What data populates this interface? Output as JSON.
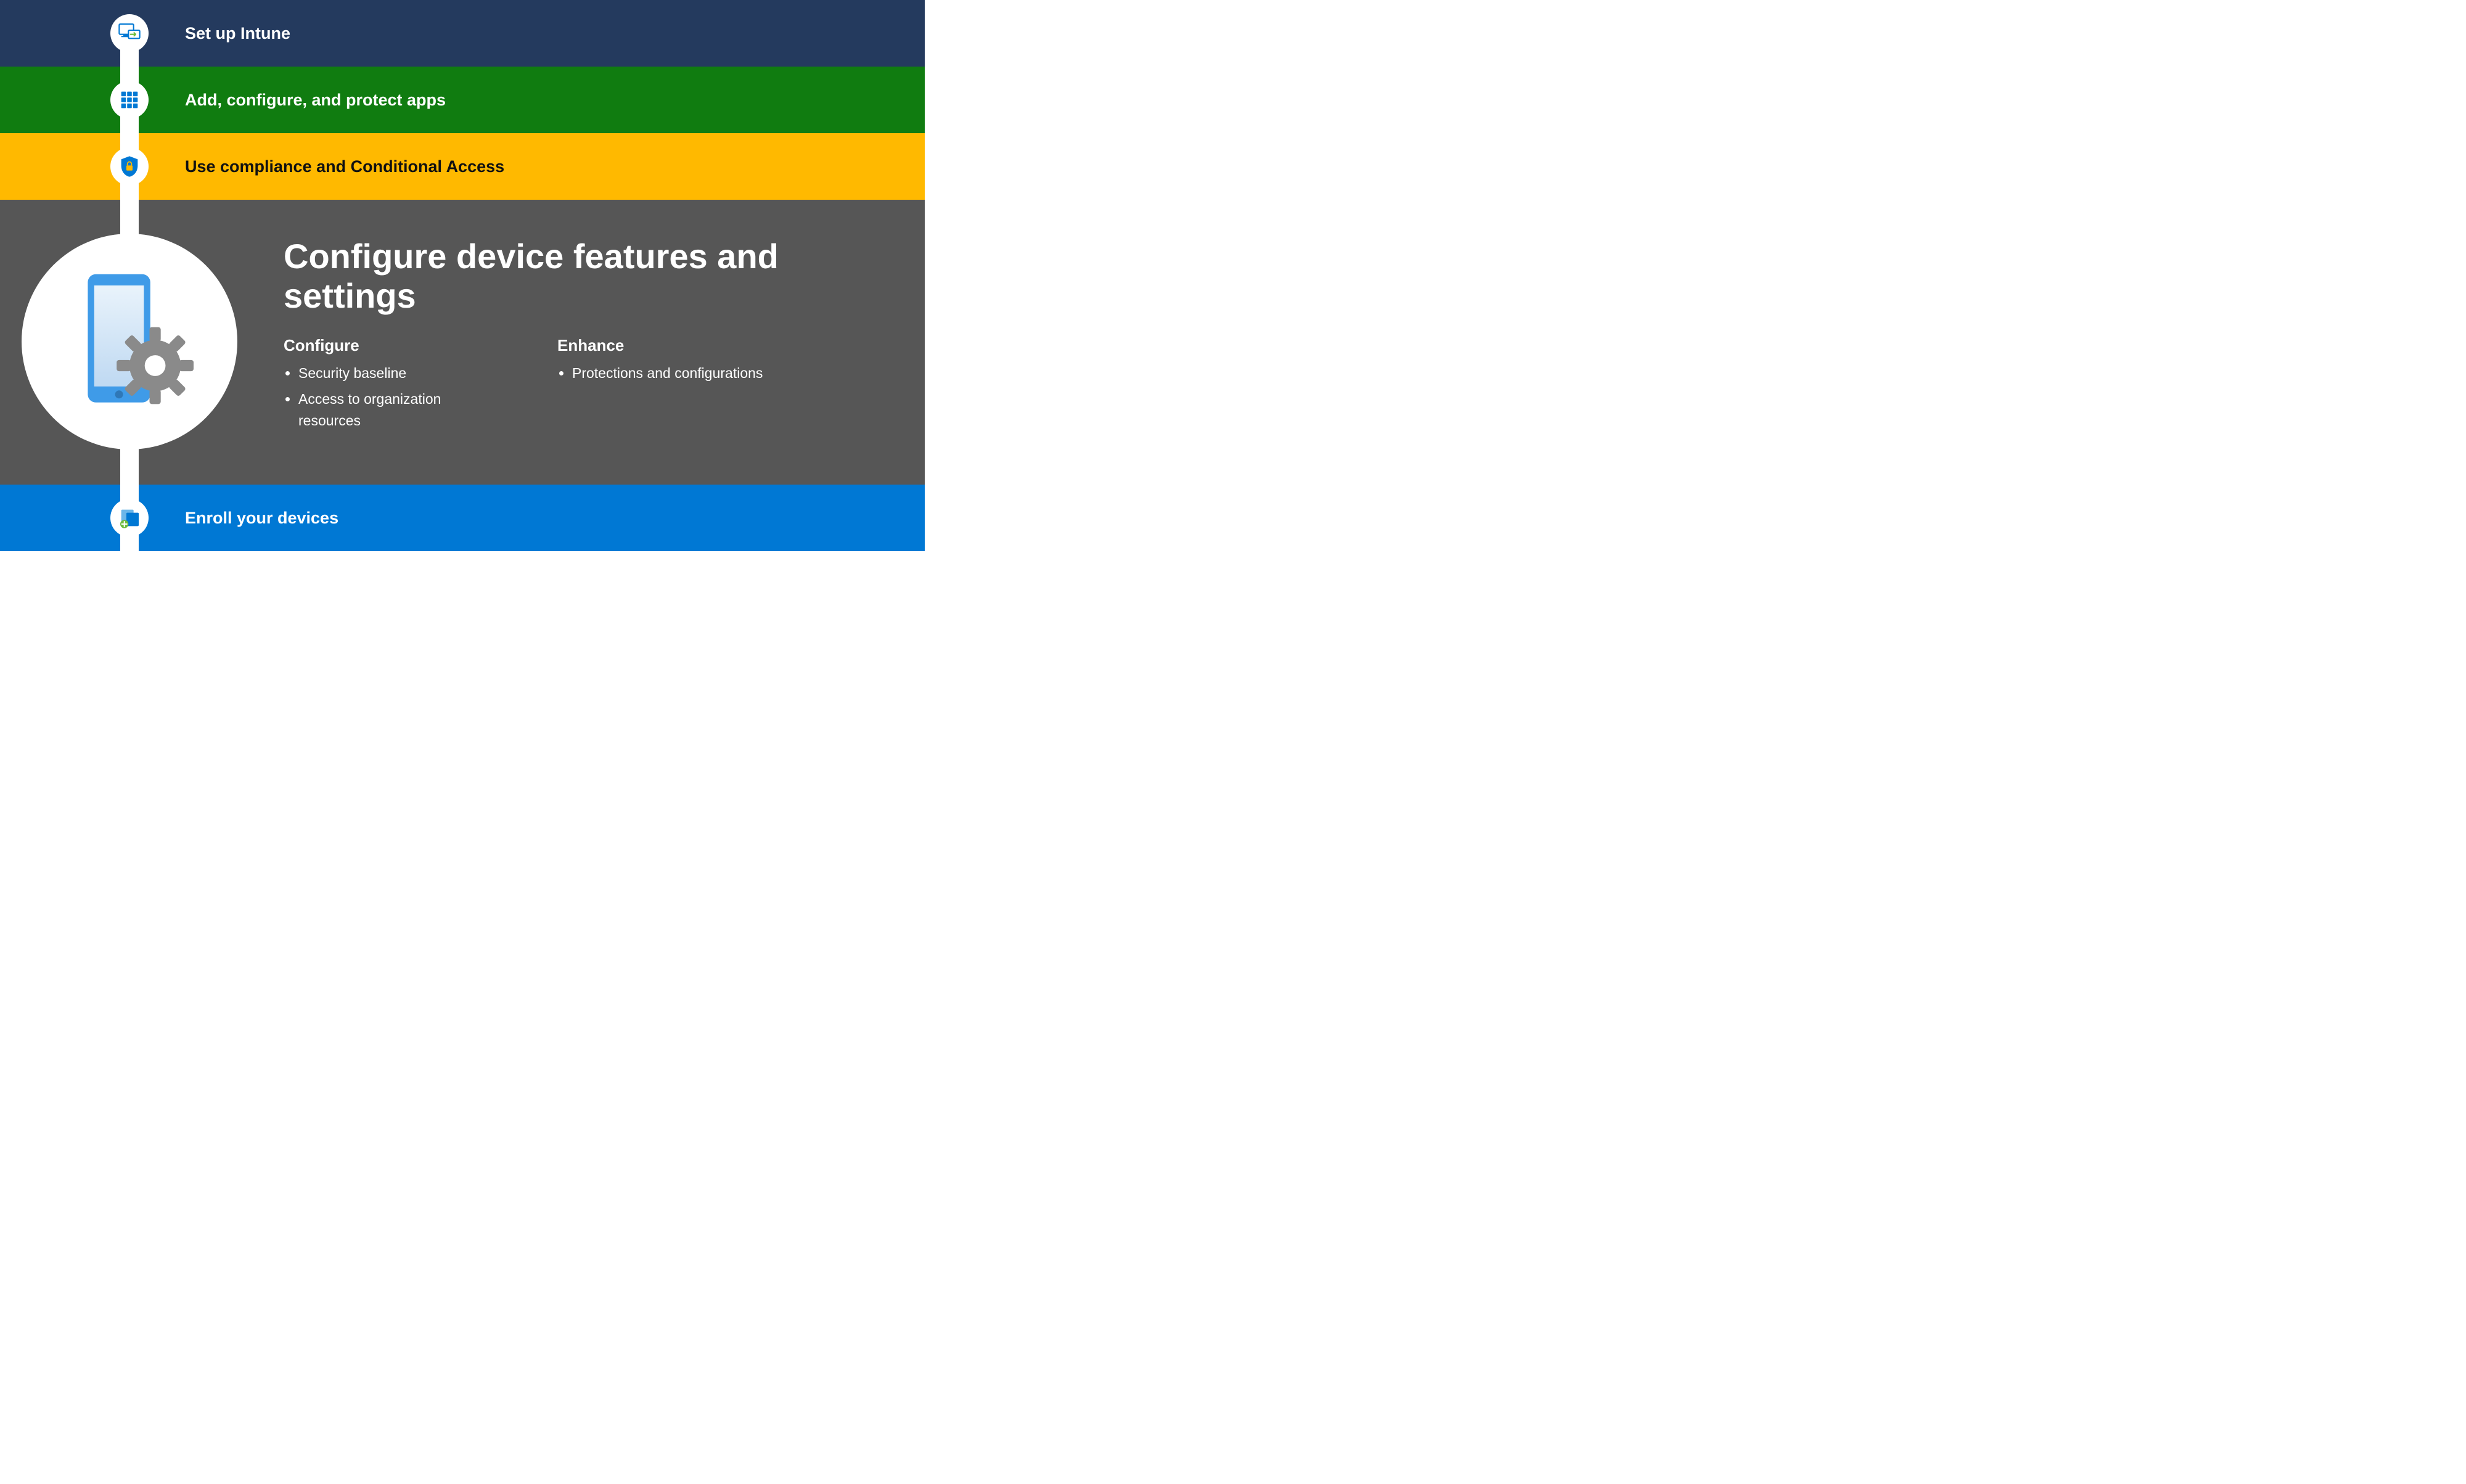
{
  "steps": {
    "s1": {
      "label": "Set up Intune",
      "icon": "monitor-arrow-icon"
    },
    "s2": {
      "label": "Add, configure, and protect apps",
      "icon": "apps-grid-icon"
    },
    "s3": {
      "label": "Use compliance and Conditional Access",
      "icon": "shield-lock-icon"
    },
    "s4": {
      "title": "Configure device features and settings",
      "icon": "device-gear-icon",
      "configure": {
        "heading": "Configure",
        "items": [
          "Security baseline",
          "Access to organization resources"
        ]
      },
      "enhance": {
        "heading": "Enhance",
        "items": [
          "Protections and configurations"
        ]
      }
    },
    "s5": {
      "label": "Enroll your devices",
      "icon": "devices-plus-icon"
    }
  },
  "colors": {
    "band1": "#243A5E",
    "band2": "#107C10",
    "band3": "#FFB900",
    "band4": "#565656",
    "band5": "#0078D4",
    "accent": "#0078D4"
  }
}
